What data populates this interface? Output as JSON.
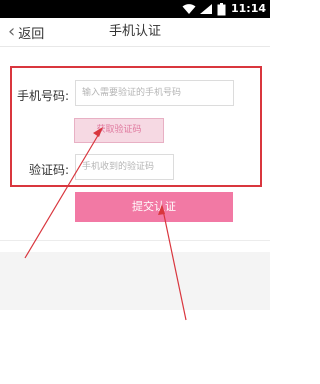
{
  "status_bar": {
    "time": "11:14",
    "icons": [
      "wifi-icon",
      "signal-icon",
      "battery-icon"
    ]
  },
  "nav": {
    "back_label": "返回",
    "title": "手机认证"
  },
  "form": {
    "phone_label": "手机号码:",
    "phone_placeholder": "输入需要验证的手机号码",
    "get_code_label": "获取验证码",
    "code_label": "验证码:",
    "code_placeholder": "手机收到的验证码",
    "submit_label": "提交认证"
  },
  "colors": {
    "accent": "#f279a4",
    "annotation": "#d9363e"
  }
}
